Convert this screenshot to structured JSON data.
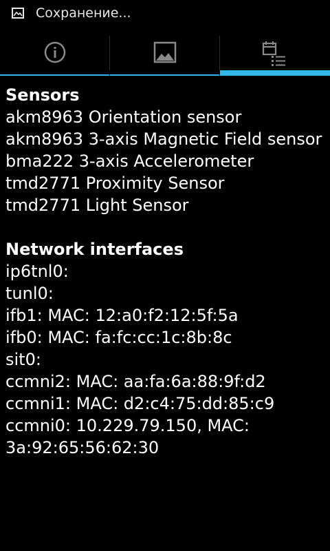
{
  "status_bar": {
    "text": "Сохранение...",
    "icon": "image-icon"
  },
  "tabs": [
    {
      "icon": "info-icon",
      "active": false
    },
    {
      "icon": "image-icon",
      "active": false
    },
    {
      "icon": "calendar-list-icon",
      "active": true
    }
  ],
  "colors": {
    "background": "#000000",
    "text": "#ffffff",
    "accent": "#33b5e5",
    "icon_gray": "#8a8a8a"
  },
  "sections": [
    {
      "title": "Sensors",
      "items": [
        "akm8963 Orientation sensor",
        "akm8963 3-axis Magnetic Field sensor",
        "bma222 3-axis Accelerometer",
        "tmd2771 Proximity Sensor",
        "tmd2771 Light Sensor"
      ]
    },
    {
      "title": "Network interfaces",
      "items": [
        "ip6tnl0:",
        "tunl0:",
        "ifb1: MAC: 12:a0:f2:12:5f:5a",
        "ifb0: MAC: fa:fc:cc:1c:8b:8c",
        "sit0:",
        "ccmni2: MAC: aa:fa:6a:88:9f:d2",
        "ccmni1: MAC: d2:c4:75:dd:85:c9",
        "ccmni0: 10.229.79.150, MAC: 3a:92:65:56:62:30"
      ]
    }
  ]
}
